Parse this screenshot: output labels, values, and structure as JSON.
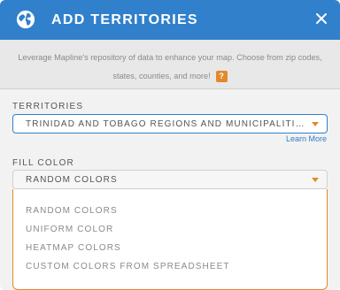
{
  "dialog": {
    "title": "ADD TERRITORIES",
    "intro_text": "Leverage Mapline's repository of data to enhance your map. Choose from zip codes, states, counties, and more!",
    "help_label": "?"
  },
  "territories": {
    "label": "TERRITORIES",
    "value": "TRINIDAD AND TOBAGO REGIONS AND MUNICIPALITIES",
    "learn_more": "Learn More"
  },
  "fill_color": {
    "label": "FILL COLOR",
    "value": "RANDOM COLORS",
    "options": [
      "RANDOM COLORS",
      "UNIFORM COLOR",
      "HEATMAP COLORS",
      "CUSTOM COLORS FROM SPREADSHEET"
    ]
  },
  "colors": {
    "header": "#3080cc",
    "accent": "#e08a2c"
  }
}
